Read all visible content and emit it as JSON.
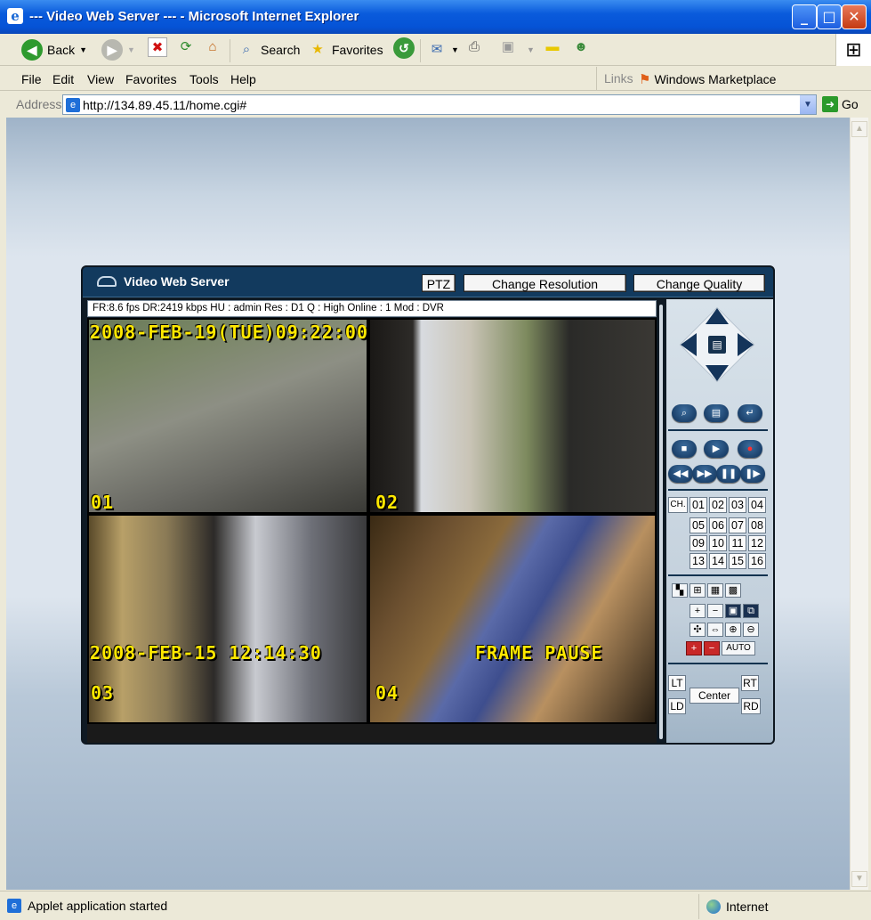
{
  "window": {
    "title": "--- Video Web Server --- - Microsoft Internet Explorer",
    "colors": {
      "titlebar": "#0553d6",
      "close": "#c43a12"
    }
  },
  "toolbar": {
    "back": "Back",
    "search": "Search",
    "favorites": "Favorites"
  },
  "menu": {
    "items": [
      "File",
      "Edit",
      "View",
      "Favorites",
      "Tools",
      "Help"
    ],
    "links_label": "Links",
    "links_item": "Windows Marketplace"
  },
  "address": {
    "label": "Address",
    "url": "http://134.89.45.11/home.cgi#",
    "go": "Go"
  },
  "applet": {
    "title": "Video Web Server",
    "buttons": {
      "ptz": "PTZ",
      "resolution": "Change Resolution",
      "quality": "Change Quality"
    },
    "info": "FR:8.6 fps  DR:2419 kbps  HU : admin  Res : D1  Q : High  Online : 1 Mod : DVR",
    "osd_top": "2008-FEB-19(TUE)09:22:00",
    "osd_mid": "2008-FEB-15 12:14:30",
    "osd_pause": "FRAME PAUSE",
    "cameras": [
      "01",
      "02",
      "03",
      "04"
    ],
    "colors": {
      "osd": "#ffe800",
      "header": "#123a5e"
    }
  },
  "panel": {
    "ch_label": "CH.",
    "channels": [
      "01",
      "02",
      "03",
      "04",
      "05",
      "06",
      "07",
      "08",
      "09",
      "10",
      "11",
      "12",
      "13",
      "14",
      "15",
      "16"
    ],
    "auto": "AUTO",
    "ptz_dirs": {
      "lt": "LT",
      "rt": "RT",
      "ld": "LD",
      "rd": "RD",
      "center": "Center"
    }
  },
  "status": {
    "message": "Applet application started",
    "zone": "Internet"
  }
}
